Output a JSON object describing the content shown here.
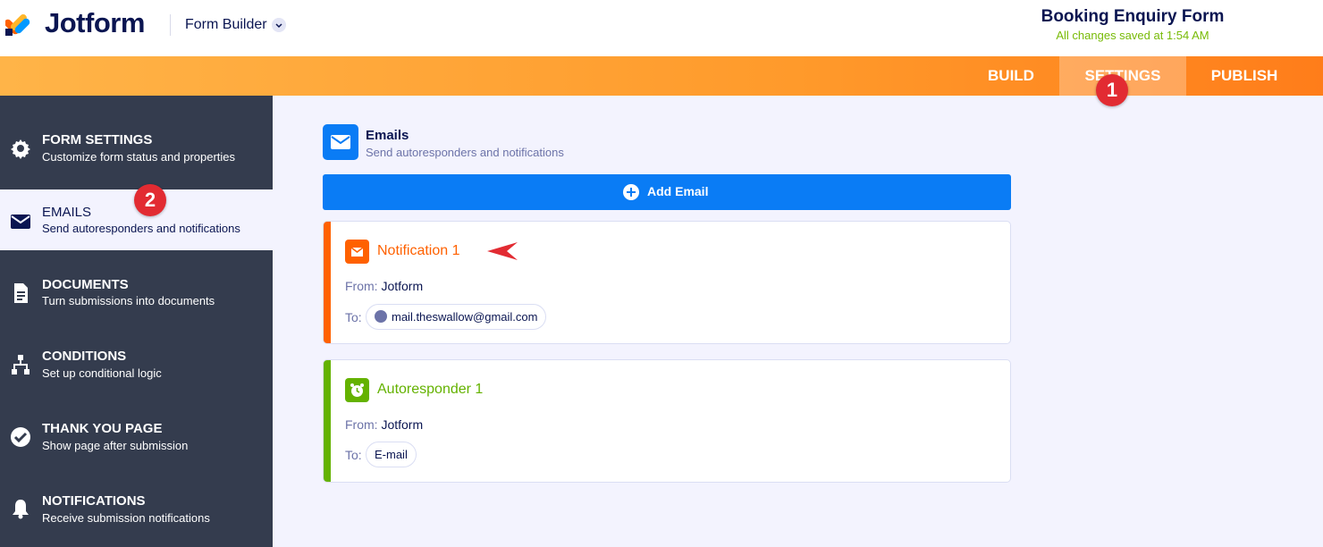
{
  "header": {
    "brand": "Jotform",
    "builder_label": "Form Builder",
    "form_title": "Booking Enquiry Form",
    "saved_status": "All changes saved at 1:54 AM"
  },
  "nav": {
    "tabs": [
      {
        "label": "BUILD",
        "active": false
      },
      {
        "label": "SETTINGS",
        "active": true
      },
      {
        "label": "PUBLISH",
        "active": false
      }
    ],
    "accent_color": "#ff9a2b"
  },
  "sidebar": {
    "items": [
      {
        "title": "FORM SETTINGS",
        "subtitle": "Customize form status and properties",
        "icon": "gear-icon"
      },
      {
        "title": "EMAILS",
        "subtitle": "Send autoresponders and notifications",
        "icon": "envelope-icon",
        "active": true
      },
      {
        "title": "DOCUMENTS",
        "subtitle": "Turn submissions into documents",
        "icon": "document-icon"
      },
      {
        "title": "CONDITIONS",
        "subtitle": "Set up conditional logic",
        "icon": "sitemap-icon"
      },
      {
        "title": "THANK YOU PAGE",
        "subtitle": "Show page after submission",
        "icon": "check-circle-icon"
      },
      {
        "title": "NOTIFICATIONS",
        "subtitle": "Receive submission notifications",
        "icon": "bell-icon"
      }
    ]
  },
  "annotations": {
    "badge_1": "1",
    "badge_2": "2",
    "badge_color": "#e22b32"
  },
  "main": {
    "section_title": "Emails",
    "section_subtitle": "Send autoresponders and notifications",
    "add_button": "Add Email",
    "primary_color": "#0a7cf5",
    "cards": [
      {
        "name": "Notification 1",
        "from_label": "From:",
        "from_value": "Jotform",
        "to_label": "To:",
        "to_value": "mail.theswallow@gmail.com",
        "color": "#ff6100"
      },
      {
        "name": "Autoresponder 1",
        "from_label": "From:",
        "from_value": "Jotform",
        "to_label": "To:",
        "to_value": "E-mail",
        "color": "#64b200"
      }
    ]
  }
}
